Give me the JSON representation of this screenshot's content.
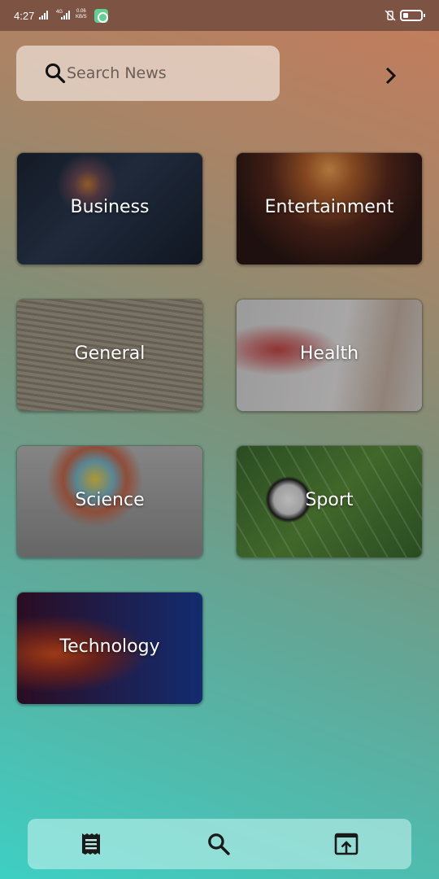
{
  "status_bar": {
    "time": "4:27",
    "network_1": "4G",
    "speed_value": "0.06",
    "speed_unit": "KB/S"
  },
  "search": {
    "placeholder": "Search News",
    "value": ""
  },
  "categories": [
    {
      "label": "Business"
    },
    {
      "label": "Entertainment"
    },
    {
      "label": "General"
    },
    {
      "label": "Health"
    },
    {
      "label": "Science"
    },
    {
      "label": "Sport"
    },
    {
      "label": "Technology"
    }
  ],
  "bottom_nav": {
    "items": [
      "news-icon",
      "search-icon",
      "open-in-icon"
    ]
  },
  "colors": {
    "status_bar": "#7d5444",
    "gradient_top": "#c47c5c",
    "gradient_bottom": "#3ecfc3",
    "icon": "#1a1a1a"
  }
}
